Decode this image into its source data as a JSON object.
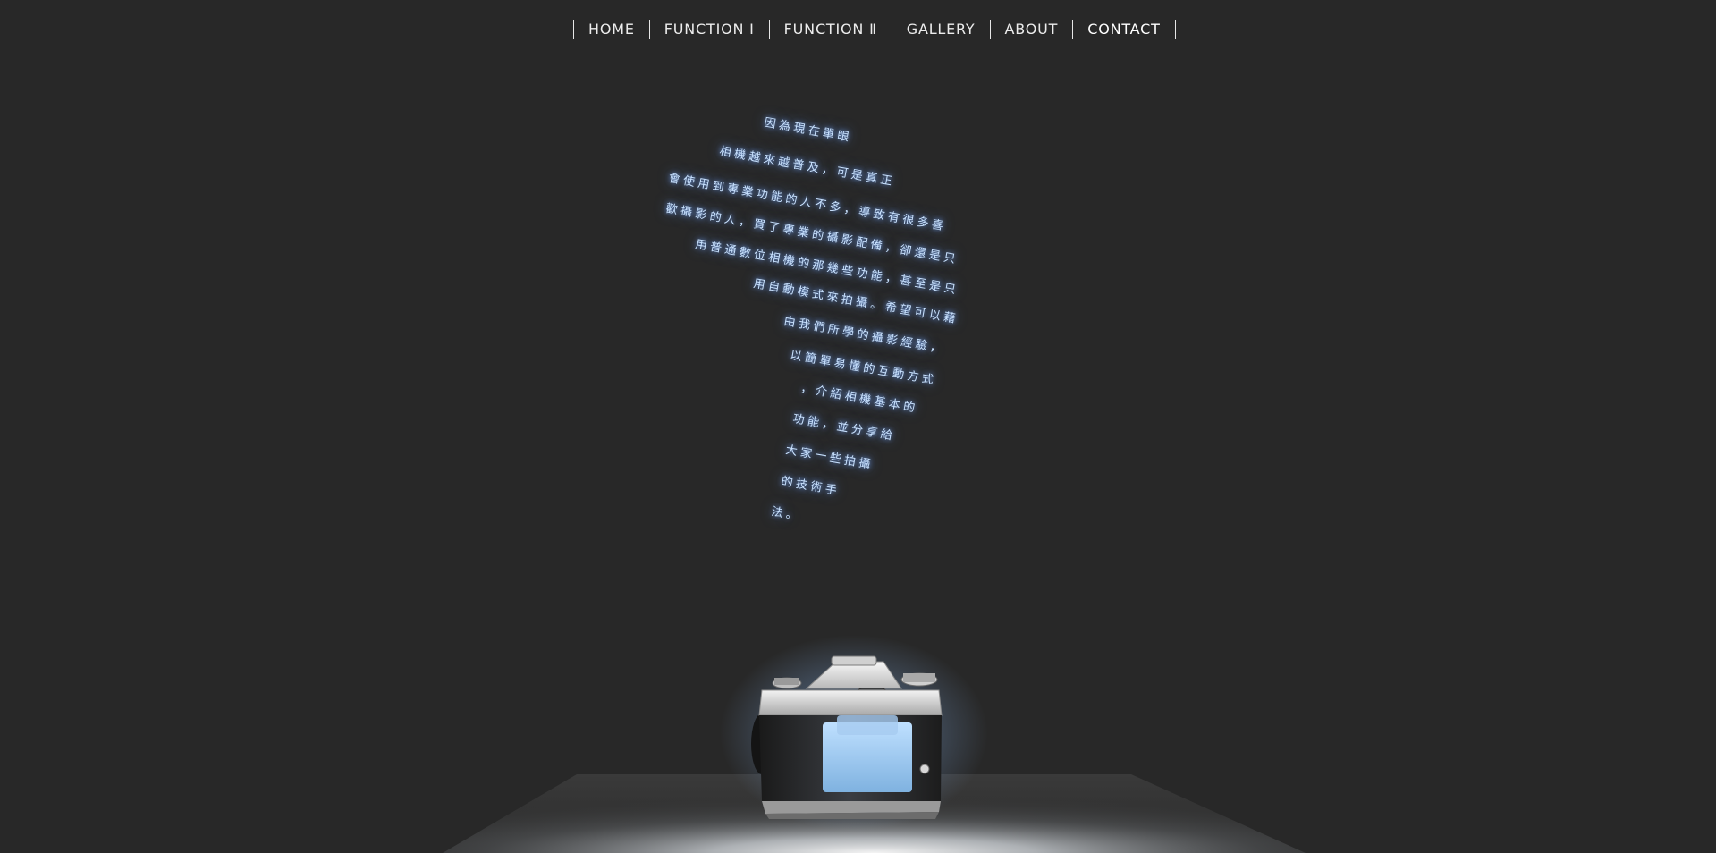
{
  "nav": {
    "items": [
      {
        "label": "HOME"
      },
      {
        "label": "FUNCTION Ⅰ"
      },
      {
        "label": "FUNCTION Ⅱ"
      },
      {
        "label": "GALLERY"
      },
      {
        "label": "ABOUT"
      },
      {
        "label": "CONTACT"
      }
    ]
  },
  "intro": {
    "lines": [
      "因為現在單眼",
      "相機越來越普及，可是真正",
      "會使用到專業功能的人不多，導致有很多喜",
      "歡攝影的人，買了專業的攝影配備，卻還是只",
      "用普通數位相機的那幾些功能，甚至是只",
      "用自動模式來拍攝。希望可以藉",
      "由我們所學的攝影經驗，",
      "以簡單易懂的互動方式",
      "，介紹相機基本的",
      "功能，並分享給",
      "大家一些拍攝",
      "的技術手",
      "法。"
    ]
  },
  "colors": {
    "background": "#282828",
    "nav_text": "#ececec",
    "glow_text": "#c9e2ff",
    "glow": "#78aaff"
  },
  "icons": {
    "hero": "camera-icon"
  }
}
